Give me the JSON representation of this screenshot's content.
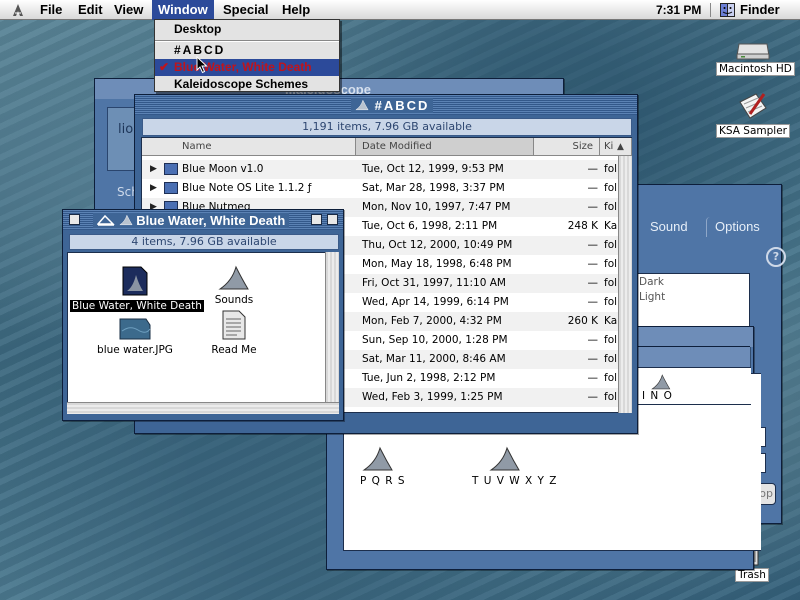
{
  "menubar": {
    "items": [
      "File",
      "Edit",
      "View",
      "Window",
      "Special",
      "Help"
    ],
    "active": "Window",
    "clock": "7:31 PM",
    "app": "Finder"
  },
  "window_menu": {
    "items": [
      "Desktop",
      "#ABCD",
      "Blue Water, White Death",
      "Kaleidoscope Schemes"
    ],
    "checked_item": "Blue Water, White Death"
  },
  "desktop_icons": {
    "hd": "Macintosh HD",
    "sampler": "KSA Sampler",
    "trash": "Trash"
  },
  "kaleidoscope_window": {
    "title": "Kaleidoscope",
    "title_partial": "...aleidoscope",
    "tabs": [
      "Sound",
      "Options"
    ],
    "list_items": [
      "Dark",
      "Light"
    ],
    "button_partial": "ktop",
    "side_labels": [
      "lio",
      "Sch"
    ]
  },
  "letters_window": {
    "items": [
      "I N O",
      "P Q R S",
      "T U V W X Y Z"
    ]
  },
  "abcd_window": {
    "title": "#ABCD",
    "status": "1,191 items, 7.96 GB available",
    "columns": [
      "Name",
      "Date Modified",
      "Size",
      "Ki"
    ],
    "rows": [
      {
        "name": "Blue Moon v1.0",
        "date": "Tue, Oct 12, 1999, 9:53 PM",
        "size": "—",
        "kind": "fol"
      },
      {
        "name": "Blue Note OS Lite 1.1.2 ƒ",
        "date": "Sat, Mar 28, 1998, 3:37 PM",
        "size": "—",
        "kind": "fol"
      },
      {
        "name": "Blue Nutmeg",
        "date": "Mon, Nov 10, 1997, 7:47 PM",
        "size": "—",
        "kind": "fol"
      },
      {
        "name": "",
        "date": "Tue, Oct 6, 1998, 2:11 PM",
        "size": "248 K",
        "kind": "Ka"
      },
      {
        "name": "",
        "date": "Thu, Oct 12, 2000, 10:49 PM",
        "size": "—",
        "kind": "fol"
      },
      {
        "name": "",
        "date": "Mon, May 18, 1998, 6:48 PM",
        "size": "—",
        "kind": "fol"
      },
      {
        "name": "",
        "date": "Fri, Oct 31, 1997, 11:10 AM",
        "size": "—",
        "kind": "fol"
      },
      {
        "name": "",
        "date": "Wed, Apr 14, 1999, 6:14 PM",
        "size": "—",
        "kind": "fol"
      },
      {
        "name": "",
        "date": "Mon, Feb 7, 2000, 4:32 PM",
        "size": "260 K",
        "kind": "Ka"
      },
      {
        "name": "",
        "date": "Sun, Sep 10, 2000, 1:28 PM",
        "size": "—",
        "kind": "fol"
      },
      {
        "name": "",
        "date": "Sat, Mar 11, 2000, 8:46 AM",
        "size": "—",
        "kind": "fol"
      },
      {
        "name": "",
        "date": "Tue, Jun 2, 1998, 2:12 PM",
        "size": "—",
        "kind": "fol"
      },
      {
        "name": "",
        "date": "Wed, Feb 3, 1999, 1:25 PM",
        "size": "—",
        "kind": "fol"
      }
    ]
  },
  "bwwd_window": {
    "title": "Blue Water, White Death",
    "status": "4 items, 7.96 GB available",
    "icons": [
      "Blue Water, White Death",
      "Sounds",
      "blue water.JPG",
      "Read Me"
    ]
  }
}
